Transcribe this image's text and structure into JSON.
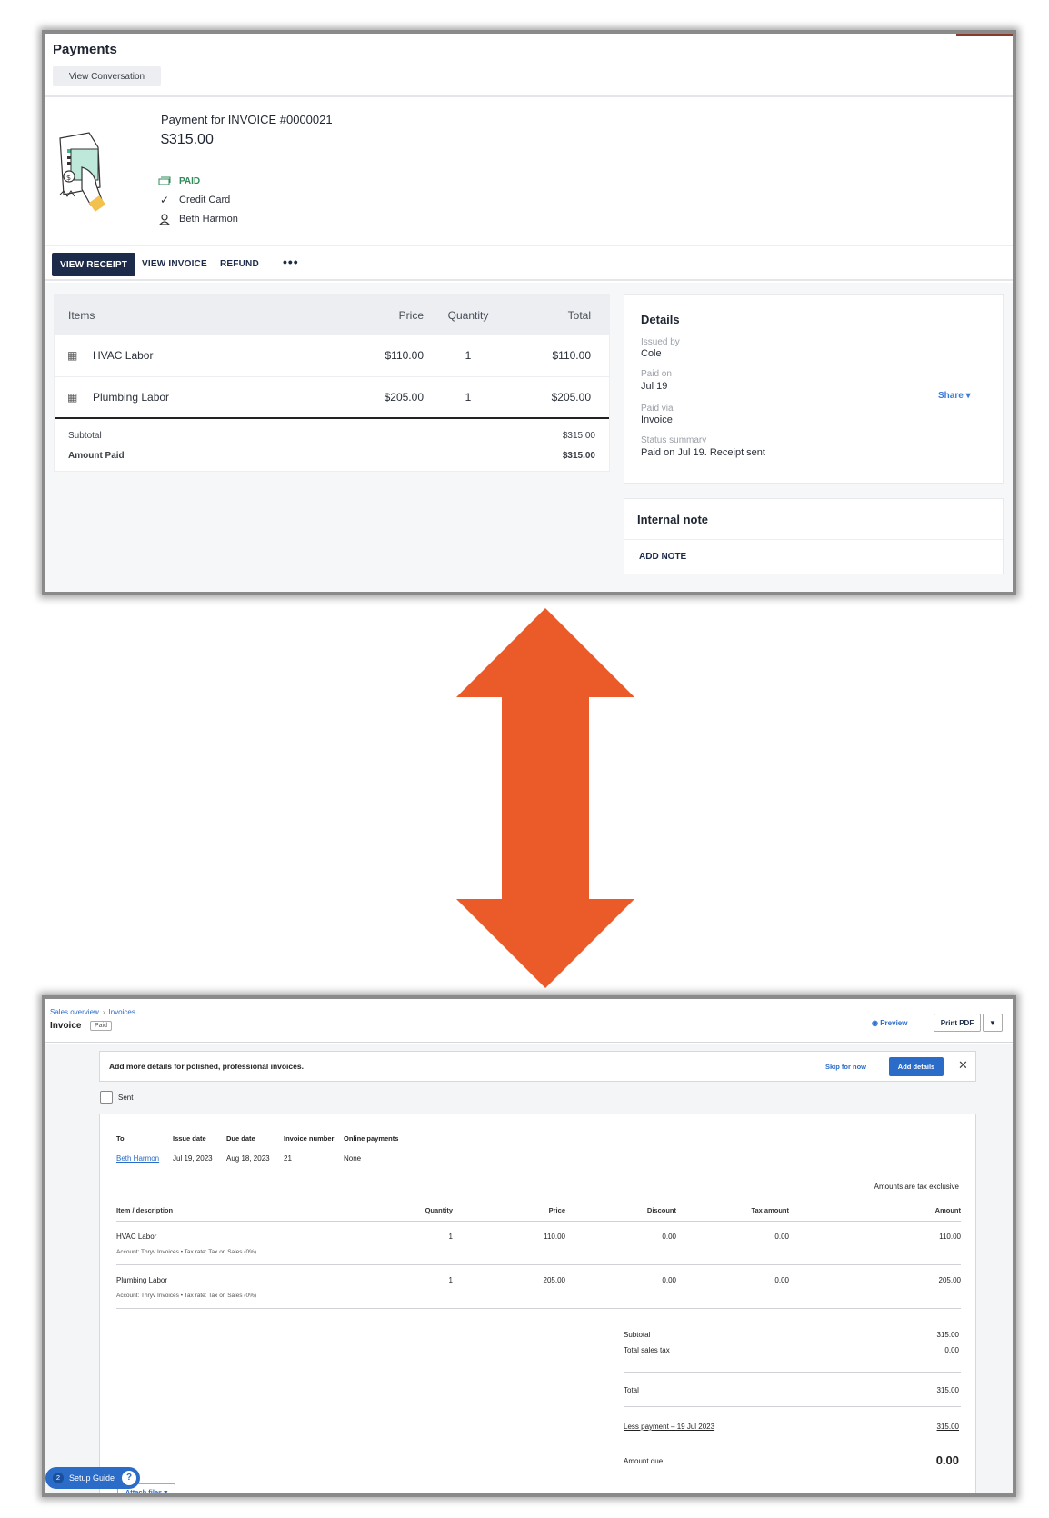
{
  "colors": {
    "arrow": "#EB5B2A",
    "navy": "#1C2B4A",
    "paid_green": "#2E8B57",
    "link_blue": "#2A6CC8"
  },
  "payments": {
    "title": "Payments",
    "view_conversation": "View Conversation",
    "payment_title": "Payment for INVOICE #0000021",
    "amount": "$315.00",
    "status": "PAID",
    "method": "Credit Card",
    "customer": "Beth Harmon",
    "actions": {
      "view_receipt": "VIEW RECEIPT",
      "view_invoice": "VIEW INVOICE",
      "refund": "REFUND",
      "more": "•••"
    },
    "items_table": {
      "headers": [
        "Items",
        "Price",
        "Quantity",
        "Total"
      ],
      "rows": [
        {
          "name": "HVAC Labor",
          "price": "$110.00",
          "qty": "1",
          "total": "$110.00"
        },
        {
          "name": "Plumbing Labor",
          "price": "$205.00",
          "qty": "1",
          "total": "$205.00"
        }
      ],
      "subtotal_label": "Subtotal",
      "subtotal": "$315.00",
      "amount_paid_label": "Amount Paid",
      "amount_paid": "$315.00"
    },
    "details": {
      "title": "Details",
      "issued_by_label": "Issued by",
      "issued_by": "Cole",
      "paid_on_label": "Paid on",
      "paid_on": "Jul 19",
      "share": "Share",
      "paid_via_label": "Paid via",
      "paid_via": "Invoice",
      "status_summary_label": "Status summary",
      "status_summary": "Paid on Jul 19. Receipt sent"
    },
    "internal_note": {
      "title": "Internal note",
      "add_note": "ADD NOTE"
    }
  },
  "invoice": {
    "breadcrumb": [
      "Sales overview",
      "Invoices"
    ],
    "title": "Invoice",
    "badge": "Paid",
    "preview": "Preview",
    "print_pdf": "Print PDF",
    "banner": {
      "text": "Add more details for polished, professional invoices.",
      "skip": "Skip for now",
      "add_details": "Add details",
      "close": "✕"
    },
    "sent_label": "Sent",
    "fields": {
      "to_label": "To",
      "to": "Beth Harmon",
      "issue_date_label": "Issue date",
      "issue_date": "Jul 19, 2023",
      "due_date_label": "Due date",
      "due_date": "Aug 18, 2023",
      "invoice_number_label": "Invoice number",
      "invoice_number": "21",
      "online_payments_label": "Online payments",
      "online_payments": "None"
    },
    "tax_note": "Amounts are tax exclusive",
    "table": {
      "headers": [
        "Item / description",
        "Quantity",
        "Price",
        "Discount",
        "Tax amount",
        "Amount"
      ],
      "rows": [
        {
          "item": "HVAC Labor",
          "sub": "Account: Thryv Invoices • Tax rate: Tax on Sales (0%)",
          "qty": "1",
          "price": "110.00",
          "discount": "0.00",
          "tax": "0.00",
          "amount": "110.00"
        },
        {
          "item": "Plumbing Labor",
          "sub": "Account: Thryv Invoices • Tax rate: Tax on Sales (0%)",
          "qty": "1",
          "price": "205.00",
          "discount": "0.00",
          "tax": "0.00",
          "amount": "205.00"
        }
      ]
    },
    "totals": {
      "subtotal_label": "Subtotal",
      "subtotal": "315.00",
      "sales_tax_label": "Total sales tax",
      "sales_tax": "0.00",
      "total_label": "Total",
      "total": "315.00",
      "less_payment_label": "Less payment – 19 Jul 2023",
      "less_payment": "315.00",
      "amount_due_label": "Amount due",
      "amount_due": "0.00"
    },
    "attach_files": "Attach files",
    "setup_guide": {
      "count": "2",
      "label": "Setup Guide"
    }
  }
}
